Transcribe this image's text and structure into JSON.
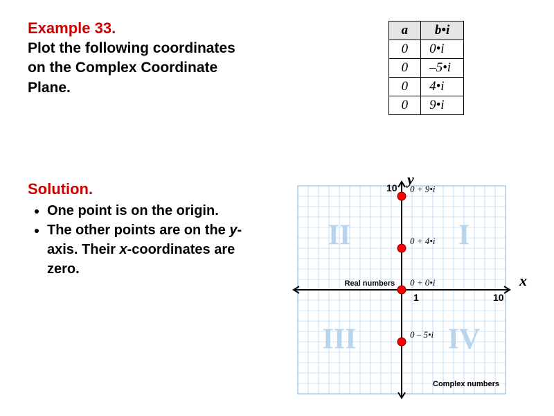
{
  "example": {
    "title": "Example 33.",
    "prompt": "Plot the following coordinates on the Complex Coordinate Plane."
  },
  "table": {
    "header_a": "a",
    "header_bi": "b•i",
    "rows": [
      {
        "a": "0",
        "bi": "0•i"
      },
      {
        "a": "0",
        "bi": "–5•i"
      },
      {
        "a": "0",
        "bi": "4•i"
      },
      {
        "a": "0",
        "bi": "9•i"
      }
    ]
  },
  "solution": {
    "title": "Solution.",
    "bullet1": "One point is on the origin.",
    "bullet2_a": "The other points are on the ",
    "bullet2_y": "y",
    "bullet2_b": "-axis. Their ",
    "bullet2_x": "x",
    "bullet2_c": "-coordinates are zero."
  },
  "chart_data": {
    "type": "scatter",
    "title": "",
    "xlabel": "x",
    "ylabel": "y",
    "xlim": [
      -10,
      10
    ],
    "ylim": [
      -10,
      10
    ],
    "x_ticks": [
      1,
      10
    ],
    "y_ticks": [
      10
    ],
    "axis_region_label_real": "Real numbers",
    "axis_region_label_complex": "Complex numbers",
    "quadrants": {
      "I": "I",
      "II": "II",
      "III": "III",
      "IV": "IV"
    },
    "series": [
      {
        "name": "points",
        "x": [
          0,
          0,
          0,
          0
        ],
        "y": [
          0,
          -5,
          4,
          9
        ],
        "labels": [
          "0 + 0•i",
          "0 – 5•i",
          "0 + 4•i",
          "0 + 9•i"
        ]
      }
    ]
  },
  "colors": {
    "accent": "#cc0000",
    "grid": "#7fb3e6",
    "quadrant": "#b8d4ec",
    "point": "#ff0000"
  }
}
